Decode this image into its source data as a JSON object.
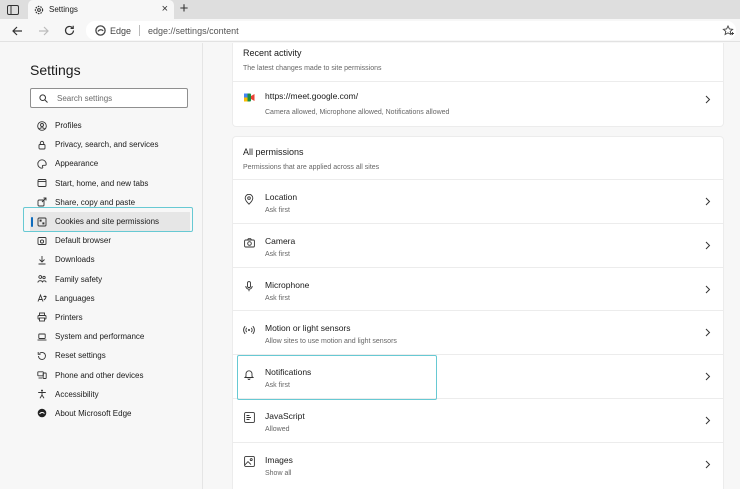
{
  "tab": {
    "title": "Settings",
    "close": "×",
    "new_tab": "+"
  },
  "address": {
    "site_label": "Edge",
    "url": "edge://settings/content"
  },
  "sidebar": {
    "title": "Settings",
    "search_placeholder": "Search settings",
    "items": [
      {
        "label": "Profiles",
        "icon": "profile-icon"
      },
      {
        "label": "Privacy, search, and services",
        "icon": "lock-icon"
      },
      {
        "label": "Appearance",
        "icon": "appearance-icon"
      },
      {
        "label": "Start, home, and new tabs",
        "icon": "home-icon"
      },
      {
        "label": "Share, copy and paste",
        "icon": "share-icon"
      },
      {
        "label": "Cookies and site permissions",
        "icon": "cookies-icon"
      },
      {
        "label": "Default browser",
        "icon": "browser-icon"
      },
      {
        "label": "Downloads",
        "icon": "download-icon"
      },
      {
        "label": "Family safety",
        "icon": "family-icon"
      },
      {
        "label": "Languages",
        "icon": "language-icon"
      },
      {
        "label": "Printers",
        "icon": "printer-icon"
      },
      {
        "label": "System and performance",
        "icon": "laptop-icon"
      },
      {
        "label": "Reset settings",
        "icon": "reset-icon"
      },
      {
        "label": "Phone and other devices",
        "icon": "phone-icon"
      },
      {
        "label": "Accessibility",
        "icon": "accessibility-icon"
      },
      {
        "label": "About Microsoft Edge",
        "icon": "edge-logo-icon"
      }
    ],
    "active_index": 5
  },
  "recent": {
    "title": "Recent activity",
    "subtitle": "The latest changes made to site permissions",
    "site": "https://meet.google.com/",
    "detail": "Camera allowed, Microphone allowed, Notifications allowed"
  },
  "permissions": {
    "title": "All permissions",
    "subtitle": "Permissions that are applied across all sites",
    "items": [
      {
        "title": "Location",
        "status": "Ask first",
        "icon": "location-icon"
      },
      {
        "title": "Camera",
        "status": "Ask first",
        "icon": "camera-icon"
      },
      {
        "title": "Microphone",
        "status": "Ask first",
        "icon": "microphone-icon"
      },
      {
        "title": "Motion or light sensors",
        "status": "Allow sites to use motion and light sensors",
        "icon": "sensor-icon"
      },
      {
        "title": "Notifications",
        "status": "Ask first",
        "icon": "bell-icon"
      },
      {
        "title": "JavaScript",
        "status": "Allowed",
        "icon": "javascript-icon"
      },
      {
        "title": "Images",
        "status": "Show all",
        "icon": "image-icon"
      }
    ]
  },
  "colors": {
    "accent": "#0f6cbd",
    "highlight": "#67c9d3"
  }
}
